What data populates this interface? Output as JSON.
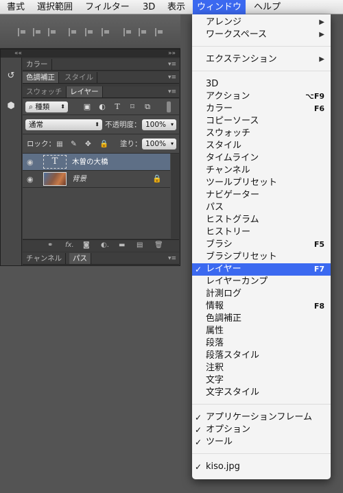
{
  "menubar": {
    "items": [
      "書式",
      "選択範囲",
      "フィルター",
      "3D",
      "表示",
      "ウィンドウ",
      "ヘルプ"
    ]
  },
  "panels": {
    "collapse_left": "««",
    "collapse_right": "»»",
    "color_tab": "カラー",
    "adjust_tab": "色調補正",
    "style_tab": "スタイル",
    "swatch_tab": "スウォッチ",
    "layer_tab": "レイヤー",
    "channel_tab": "チャンネル",
    "path_tab": "パス",
    "menu_glyph": "▾≡"
  },
  "layers_panel": {
    "filter_kind": "種類",
    "blend_mode": "通常",
    "opacity_label": "不透明度：",
    "opacity_value": "100%",
    "lock_label": "ロック：",
    "fill_label": "塗り：",
    "fill_value": "100%",
    "layers": [
      {
        "name": "木曽の大橋",
        "thumb": "T",
        "selected": true
      },
      {
        "name": "背景",
        "thumb": "",
        "selected": false,
        "locked": true
      }
    ]
  },
  "window_menu": {
    "items": [
      {
        "label": "アレンジ",
        "submenu": "▶"
      },
      {
        "label": "ワークスペース",
        "submenu": "▶"
      },
      {
        "label": "エクステンション",
        "submenu": "▶"
      },
      {
        "label": "3D"
      },
      {
        "label": "アクション",
        "shortcut": "⌥F9"
      },
      {
        "label": "カラー",
        "shortcut": "F6"
      },
      {
        "label": "コピーソース"
      },
      {
        "label": "スウォッチ"
      },
      {
        "label": "スタイル"
      },
      {
        "label": "タイムライン"
      },
      {
        "label": "チャンネル"
      },
      {
        "label": "ツールプリセット"
      },
      {
        "label": "ナビゲーター"
      },
      {
        "label": "パス"
      },
      {
        "label": "ヒストグラム"
      },
      {
        "label": "ヒストリー"
      },
      {
        "label": "ブラシ",
        "shortcut": "F5"
      },
      {
        "label": "ブラシプリセット"
      },
      {
        "label": "レイヤー",
        "shortcut": "F7",
        "checked": true,
        "highlighted": true
      },
      {
        "label": "レイヤーカンプ"
      },
      {
        "label": "計測ログ"
      },
      {
        "label": "情報",
        "shortcut": "F8"
      },
      {
        "label": "色調補正"
      },
      {
        "label": "属性"
      },
      {
        "label": "段落"
      },
      {
        "label": "段落スタイル"
      },
      {
        "label": "注釈"
      },
      {
        "label": "文字"
      },
      {
        "label": "文字スタイル"
      },
      {
        "label": "アプリケーションフレーム",
        "checked": true
      },
      {
        "label": "オプション",
        "checked": true
      },
      {
        "label": "ツール",
        "checked": true
      },
      {
        "label": "kiso.jpg",
        "checked": true
      }
    ],
    "check_glyph": "✓"
  }
}
